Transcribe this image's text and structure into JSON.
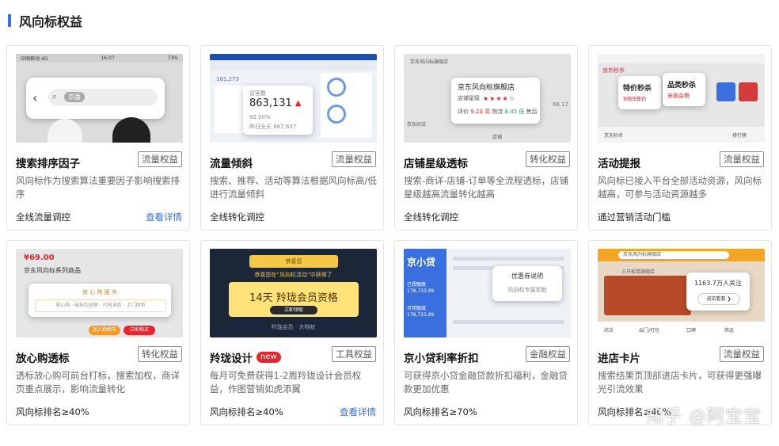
{
  "section": {
    "title": "风向标权益"
  },
  "cards": [
    {
      "name": "搜索排序因子",
      "tag": "流量权益",
      "desc": "风向标作为搜索算法重要因子影响搜索排序",
      "meta": "全线流量调控",
      "link": "查看详情",
      "thumb": {
        "status_carrier": "中国移动 4G",
        "status_time": "16:07",
        "status_battery": "73%",
        "search_chip": "京喜"
      }
    },
    {
      "name": "流量倾斜",
      "tag": "流量权益",
      "desc": "搜索、推荐、活动等算法根据风向标高/低进行流量倾斜",
      "meta": "全线转化调控",
      "link": "",
      "thumb": {
        "label": "访客数",
        "value": "863,131",
        "rate": "92.00%",
        "prev": "867,637",
        "prev_label": "昨日全天",
        "side": "101,273"
      }
    },
    {
      "name": "店铺星级透标",
      "tag": "转化权益",
      "desc": "搜索-商详-店铺-订单等全流程透标，店铺星级越高流量转化越高",
      "meta": "全线转化调控",
      "link": "",
      "thumb": {
        "shop": "京东风向标旗舰店",
        "star_label": "店铺星级",
        "rating_label": "评价",
        "rating": "9.23",
        "rating_level": "高",
        "logistics_label": "物流",
        "logistics": "8.45",
        "logistics_level": "低",
        "after_label": "售后",
        "side": "66.17",
        "side_text": "京东风向标旗舰店",
        "left_text": "京东好店",
        "bottom_text": "店铺"
      }
    },
    {
      "name": "活动提报",
      "tag": "流量权益",
      "desc": "风向标已接入平台全部活动资源，风向标越高，可参与活动资源越多",
      "meta": "通过营销活动门槛",
      "link": "",
      "thumb": {
        "flash1": "特价秒杀",
        "flash1_sub": "9块9底价",
        "flash2": "品类秒杀",
        "flash2_sub": "米面杂粮",
        "topbar": "京东秒杀",
        "bottom1": "京东秒杀",
        "bottom2": "排行榜"
      }
    },
    {
      "name": "放心购透标",
      "tag": "转化权益",
      "desc": "透标放心购可前台打标，搜索加权，商详页重点展示，影响流量转化",
      "meta": "风向标排名≥40%",
      "link": "",
      "thumb": {
        "price": "¥69.00",
        "product": "京东风向标系列商品",
        "panel_title": "放 心 购 服 务",
        "panel_text": "放心购 · 破损包退换 · 闪电退款 · 上门换新",
        "cart": "加入购物车",
        "buy": "立即购买"
      }
    },
    {
      "name": "羚珑设计",
      "tag": "工具权益",
      "new_badge": "new",
      "desc": "每月可免费获得1-2周羚珑设计会员权益，作图营销如虎添翼",
      "meta": "风向标排名≥40%",
      "link": "查看详情",
      "thumb": {
        "promo": "14天 羚珑会员资格",
        "top_badge": "恭喜您",
        "top_text": "恭喜您在“风向标活动”中获得了",
        "button": "立即领取",
        "footer": "羚珑会员 · 大特权"
      }
    },
    {
      "name": "京小贷利率折扣",
      "tag": "金融权益",
      "desc": "可获得京小贷金融贷款折扣福利，金融贷款更加优惠",
      "meta": "风向标排名≥70%",
      "link": "",
      "thumb": {
        "brand": "京小贷",
        "popup_title": "优惠券说明",
        "popup_text": "风向标专属奖励",
        "amount1": "178,733.89",
        "amount2": "178,733.89",
        "side1": "已授额度",
        "side2": "可用额度"
      }
    },
    {
      "name": "进店卡片",
      "tag": "流量权益",
      "desc": "搜索结果页顶部进店卡片，可获得更强曝光引流效果",
      "meta": "风向标排名≥40%",
      "link": "",
      "thumb": {
        "followers": "1163.7万人关注",
        "enter": "进店看看 ❯",
        "search": "京东风向标旗舰店",
        "shop_label": "三只松鼠旗舰店",
        "f1": "综合",
        "f2": "出门/打包",
        "f3": "口碑",
        "f4": "筛选"
      }
    }
  ],
  "watermark": "知乎 @阿宝宝"
}
